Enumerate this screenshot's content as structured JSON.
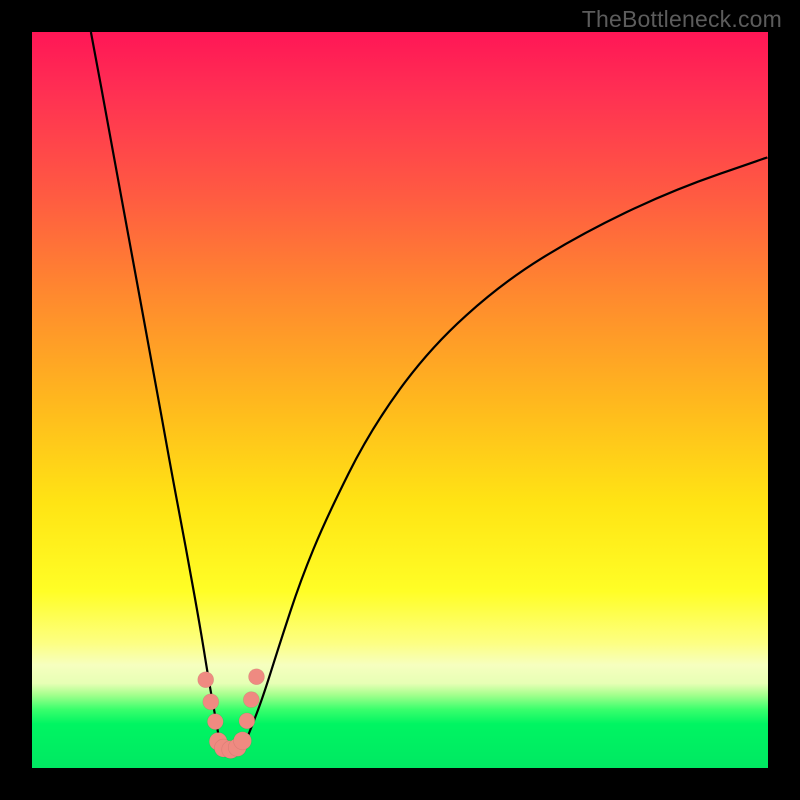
{
  "watermark": "TheBottleneck.com",
  "chart_data": {
    "type": "line",
    "title": "",
    "xlabel": "",
    "ylabel": "",
    "xlim": [
      0,
      100
    ],
    "ylim": [
      0,
      100
    ],
    "note": "Axes are unlabeled in the image; values below are inferred pixel-normalized positions (0–100) read off the plotted curve. The curve is a V-shaped bottleneck profile: the left branch falls steeply from top-left to a minimum near x≈26 y≈2, then the right branch rises concavely toward the upper-right edge.",
    "series": [
      {
        "name": "left-branch",
        "x": [
          8.0,
          10.8,
          13.5,
          16.3,
          19.0,
          20.9,
          22.7,
          24.0,
          25.0,
          25.5,
          26.0
        ],
        "y": [
          100.0,
          85.0,
          70.0,
          55.0,
          40.0,
          30.0,
          20.0,
          12.0,
          6.5,
          3.5,
          2.0
        ]
      },
      {
        "name": "right-branch",
        "x": [
          28.0,
          29.0,
          30.0,
          31.5,
          33.7,
          36.5,
          40.0,
          46.0,
          54.0,
          64.0,
          74.5,
          87.0,
          100.0
        ],
        "y": [
          2.0,
          3.5,
          6.0,
          10.0,
          17.0,
          25.5,
          34.0,
          46.0,
          57.0,
          66.0,
          72.5,
          78.5,
          83.0
        ]
      }
    ],
    "markers": {
      "note": "Pink bead markers clustered near the minimum",
      "points_left": [
        {
          "x": 23.6,
          "y": 12.0
        },
        {
          "x": 24.3,
          "y": 9.0
        },
        {
          "x": 24.9,
          "y": 6.3
        }
      ],
      "points_floor": [
        {
          "x": 25.3,
          "y": 3.6
        },
        {
          "x": 26.0,
          "y": 2.7
        },
        {
          "x": 27.0,
          "y": 2.5
        },
        {
          "x": 27.9,
          "y": 2.8
        },
        {
          "x": 28.6,
          "y": 3.7
        }
      ],
      "points_right": [
        {
          "x": 29.2,
          "y": 6.4
        },
        {
          "x": 29.8,
          "y": 9.3
        },
        {
          "x": 30.5,
          "y": 12.4
        }
      ]
    },
    "gradient_bands": [
      {
        "label": "red",
        "from_y": 100,
        "to_y": 60
      },
      {
        "label": "orange",
        "from_y": 60,
        "to_y": 35
      },
      {
        "label": "yellow",
        "from_y": 35,
        "to_y": 13
      },
      {
        "label": "pale",
        "from_y": 13,
        "to_y": 9
      },
      {
        "label": "green",
        "from_y": 9,
        "to_y": 0
      }
    ]
  }
}
